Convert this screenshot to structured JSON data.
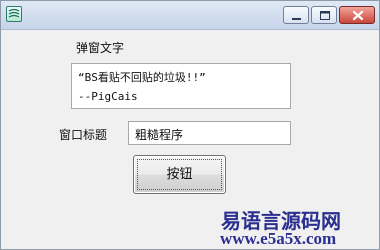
{
  "window": {
    "title": "",
    "controls": {
      "minimize": "minimize-icon",
      "maximize": "maximize-icon",
      "close": "close-icon"
    }
  },
  "form": {
    "message_label": "弹窗文字",
    "message_lines": [
      "“BS看贴不回贴的垃圾!!”",
      "--PigCais"
    ],
    "title_label": "窗口标题",
    "title_value": "粗糙程序",
    "button_label": "按钮"
  },
  "watermark": {
    "name": "易语言源码网",
    "url": "www.e5a5x.com"
  },
  "colors": {
    "titlebar": "#c7d5ea",
    "close_button": "#c9463b",
    "watermark": "#2b2f8f"
  }
}
